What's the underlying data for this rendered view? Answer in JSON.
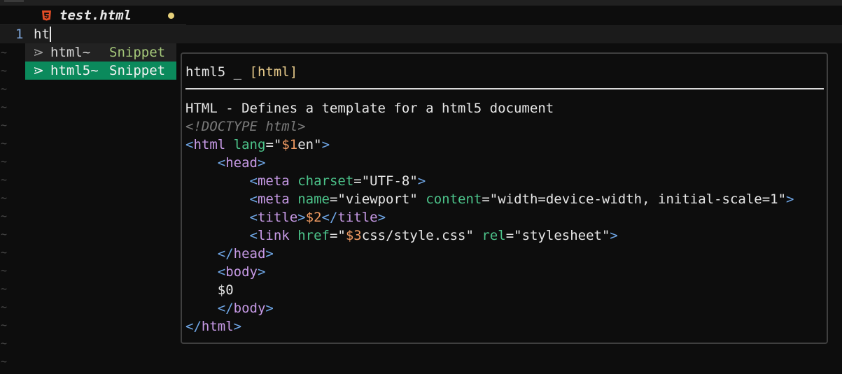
{
  "editor": {
    "tab": {
      "filename": "test.html",
      "icon": "html5-file-icon",
      "modified_indicator": "modified-dot",
      "modified_color": "#e6d07a",
      "icon_color": "#e44d26"
    },
    "line_number": "1",
    "line_text": "ht",
    "empty_line_marker": "~"
  },
  "completion_menu": {
    "items": [
      {
        "icon": "⋗",
        "label": "html~",
        "kind": "Snippet",
        "selected": false
      },
      {
        "icon": "⋗",
        "label": "html5~",
        "kind": "Snippet",
        "selected": true
      }
    ],
    "selected_color": "#0b8a5c"
  },
  "documentation": {
    "name": "html5 _ ",
    "language": "[html]",
    "description": "HTML - Defines a template for a html5 document",
    "code_lines": [
      [
        {
          "t": "<!DOCTYPE html>",
          "c": "comment"
        }
      ],
      [
        {
          "t": "<",
          "c": "punct"
        },
        {
          "t": "html",
          "c": "tag"
        },
        {
          "t": " ",
          "c": "text"
        },
        {
          "t": "lang",
          "c": "attr"
        },
        {
          "t": "=",
          "c": "op"
        },
        {
          "t": "\"",
          "c": "str"
        },
        {
          "t": "$1",
          "c": "var"
        },
        {
          "t": "en\"",
          "c": "str"
        },
        {
          "t": ">",
          "c": "punct"
        }
      ],
      [
        {
          "t": "    ",
          "c": "text"
        },
        {
          "t": "<",
          "c": "punct"
        },
        {
          "t": "head",
          "c": "tag"
        },
        {
          "t": ">",
          "c": "punct"
        }
      ],
      [
        {
          "t": "        ",
          "c": "text"
        },
        {
          "t": "<",
          "c": "punct"
        },
        {
          "t": "meta",
          "c": "tag"
        },
        {
          "t": " ",
          "c": "text"
        },
        {
          "t": "charset",
          "c": "attr"
        },
        {
          "t": "=",
          "c": "op"
        },
        {
          "t": "\"UTF-8\"",
          "c": "str"
        },
        {
          "t": ">",
          "c": "punct"
        }
      ],
      [
        {
          "t": "        ",
          "c": "text"
        },
        {
          "t": "<",
          "c": "punct"
        },
        {
          "t": "meta",
          "c": "tag"
        },
        {
          "t": " ",
          "c": "text"
        },
        {
          "t": "name",
          "c": "attr"
        },
        {
          "t": "=",
          "c": "op"
        },
        {
          "t": "\"viewport\"",
          "c": "str"
        },
        {
          "t": " ",
          "c": "text"
        },
        {
          "t": "content",
          "c": "attr"
        },
        {
          "t": "=",
          "c": "op"
        },
        {
          "t": "\"width=device-width, initial-scale=1\"",
          "c": "str"
        },
        {
          "t": ">",
          "c": "punct"
        }
      ],
      [
        {
          "t": "        ",
          "c": "text"
        },
        {
          "t": "<",
          "c": "punct"
        },
        {
          "t": "title",
          "c": "tag"
        },
        {
          "t": ">",
          "c": "punct"
        },
        {
          "t": "$2",
          "c": "var"
        },
        {
          "t": "</",
          "c": "punct"
        },
        {
          "t": "title",
          "c": "tag"
        },
        {
          "t": ">",
          "c": "punct"
        }
      ],
      [
        {
          "t": "        ",
          "c": "text"
        },
        {
          "t": "<",
          "c": "punct"
        },
        {
          "t": "link",
          "c": "tag"
        },
        {
          "t": " ",
          "c": "text"
        },
        {
          "t": "href",
          "c": "attr"
        },
        {
          "t": "=",
          "c": "op"
        },
        {
          "t": "\"",
          "c": "str"
        },
        {
          "t": "$3",
          "c": "var"
        },
        {
          "t": "css/style.css\"",
          "c": "str"
        },
        {
          "t": " ",
          "c": "text"
        },
        {
          "t": "rel",
          "c": "attr"
        },
        {
          "t": "=",
          "c": "op"
        },
        {
          "t": "\"stylesheet\"",
          "c": "str"
        },
        {
          "t": ">",
          "c": "punct"
        }
      ],
      [
        {
          "t": "    ",
          "c": "text"
        },
        {
          "t": "</",
          "c": "punct"
        },
        {
          "t": "head",
          "c": "tag"
        },
        {
          "t": ">",
          "c": "punct"
        }
      ],
      [
        {
          "t": "    ",
          "c": "text"
        },
        {
          "t": "<",
          "c": "punct"
        },
        {
          "t": "body",
          "c": "tag"
        },
        {
          "t": ">",
          "c": "punct"
        }
      ],
      [
        {
          "t": "    ",
          "c": "text"
        },
        {
          "t": "$0",
          "c": "text"
        }
      ],
      [
        {
          "t": "    ",
          "c": "text"
        },
        {
          "t": "</",
          "c": "punct"
        },
        {
          "t": "body",
          "c": "tag"
        },
        {
          "t": ">",
          "c": "punct"
        }
      ],
      [
        {
          "t": "</",
          "c": "punct"
        },
        {
          "t": "html",
          "c": "tag"
        },
        {
          "t": ">",
          "c": "punct"
        }
      ]
    ]
  }
}
